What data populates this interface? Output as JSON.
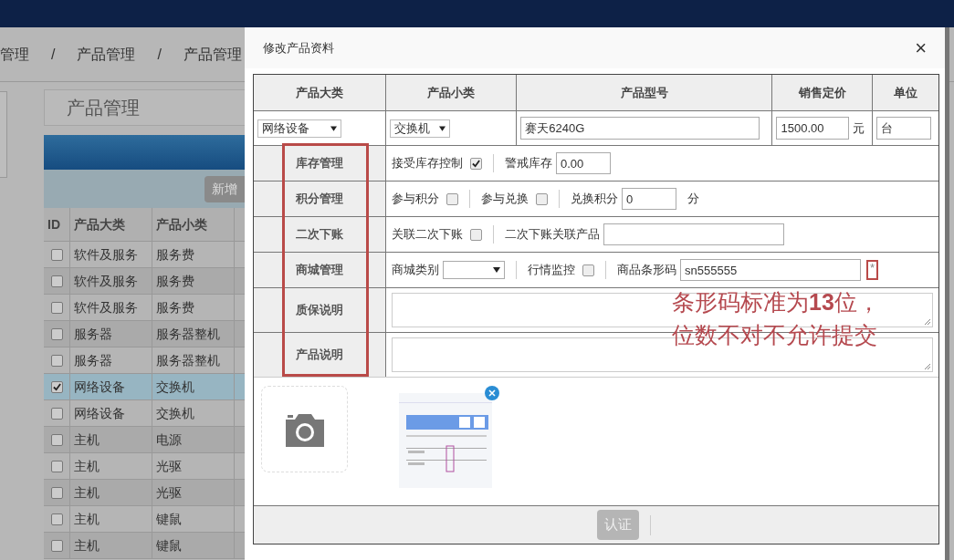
{
  "breadcrumb": [
    "管理",
    "产品管理",
    "产品管理"
  ],
  "breadcrumb_separator": "/",
  "panel_title": "产品管理",
  "toolbar_button": "新增",
  "list": {
    "columns": [
      "ID",
      "产品大类",
      "产品小类"
    ],
    "rows": [
      {
        "selected": false,
        "category": "软件及服务",
        "subcategory": "服务费"
      },
      {
        "selected": false,
        "category": "软件及服务",
        "subcategory": "服务费"
      },
      {
        "selected": false,
        "category": "软件及服务",
        "subcategory": "服务费"
      },
      {
        "selected": false,
        "category": "服务器",
        "subcategory": "服务器整机"
      },
      {
        "selected": false,
        "category": "服务器",
        "subcategory": "服务器整机"
      },
      {
        "selected": true,
        "category": "网络设备",
        "subcategory": "交换机"
      },
      {
        "selected": false,
        "category": "网络设备",
        "subcategory": "交换机"
      },
      {
        "selected": false,
        "category": "主机",
        "subcategory": "电源"
      },
      {
        "selected": false,
        "category": "主机",
        "subcategory": "光驱"
      },
      {
        "selected": false,
        "category": "主机",
        "subcategory": "光驱"
      },
      {
        "selected": false,
        "category": "主机",
        "subcategory": "键鼠"
      },
      {
        "selected": false,
        "category": "主机",
        "subcategory": "键鼠"
      }
    ]
  },
  "dialog": {
    "title": "修改产品资料",
    "close": "×",
    "columns": [
      "产品大类",
      "产品小类",
      "产品型号",
      "销售定价",
      "单位"
    ],
    "product": {
      "category": "网络设备",
      "subcategory": "交换机",
      "model": "赛天6240G",
      "price": "1500.00",
      "currency": "元",
      "unit": "台"
    },
    "sections": [
      {
        "label": "库存管理",
        "items": [
          {
            "kind": "checkbox",
            "label": "接受库存控制",
            "checked": true
          },
          {
            "kind": "number",
            "label": "警戒库存",
            "value": "0.00"
          }
        ]
      },
      {
        "label": "积分管理",
        "items": [
          {
            "kind": "checkbox",
            "label": "参与积分",
            "checked": false
          },
          {
            "kind": "checkbox",
            "label": "参与兑换",
            "checked": false
          },
          {
            "kind": "number",
            "label": "兑换积分",
            "value": "0",
            "suffix": "分"
          }
        ]
      },
      {
        "label": "二次下账",
        "items": [
          {
            "kind": "checkbox",
            "label": "关联二次下账",
            "checked": false
          },
          {
            "kind": "text",
            "label": "二次下账关联产品"
          }
        ]
      },
      {
        "label": "商城管理",
        "items": [
          {
            "kind": "select",
            "label": "商城类别"
          },
          {
            "kind": "checkbox",
            "label": "行情监控",
            "checked": false
          },
          {
            "kind": "text",
            "label": "商品条形码",
            "value": "sn555555",
            "required": "*"
          }
        ]
      },
      {
        "label": "质保说明",
        "items": [
          {
            "kind": "textarea"
          }
        ]
      },
      {
        "label": "产品说明",
        "items": [
          {
            "kind": "textarea"
          }
        ]
      }
    ],
    "submit": "认证"
  },
  "annotation": [
    "条形码标准为**13**位，",
    "位数不对不允许提交"
  ]
}
